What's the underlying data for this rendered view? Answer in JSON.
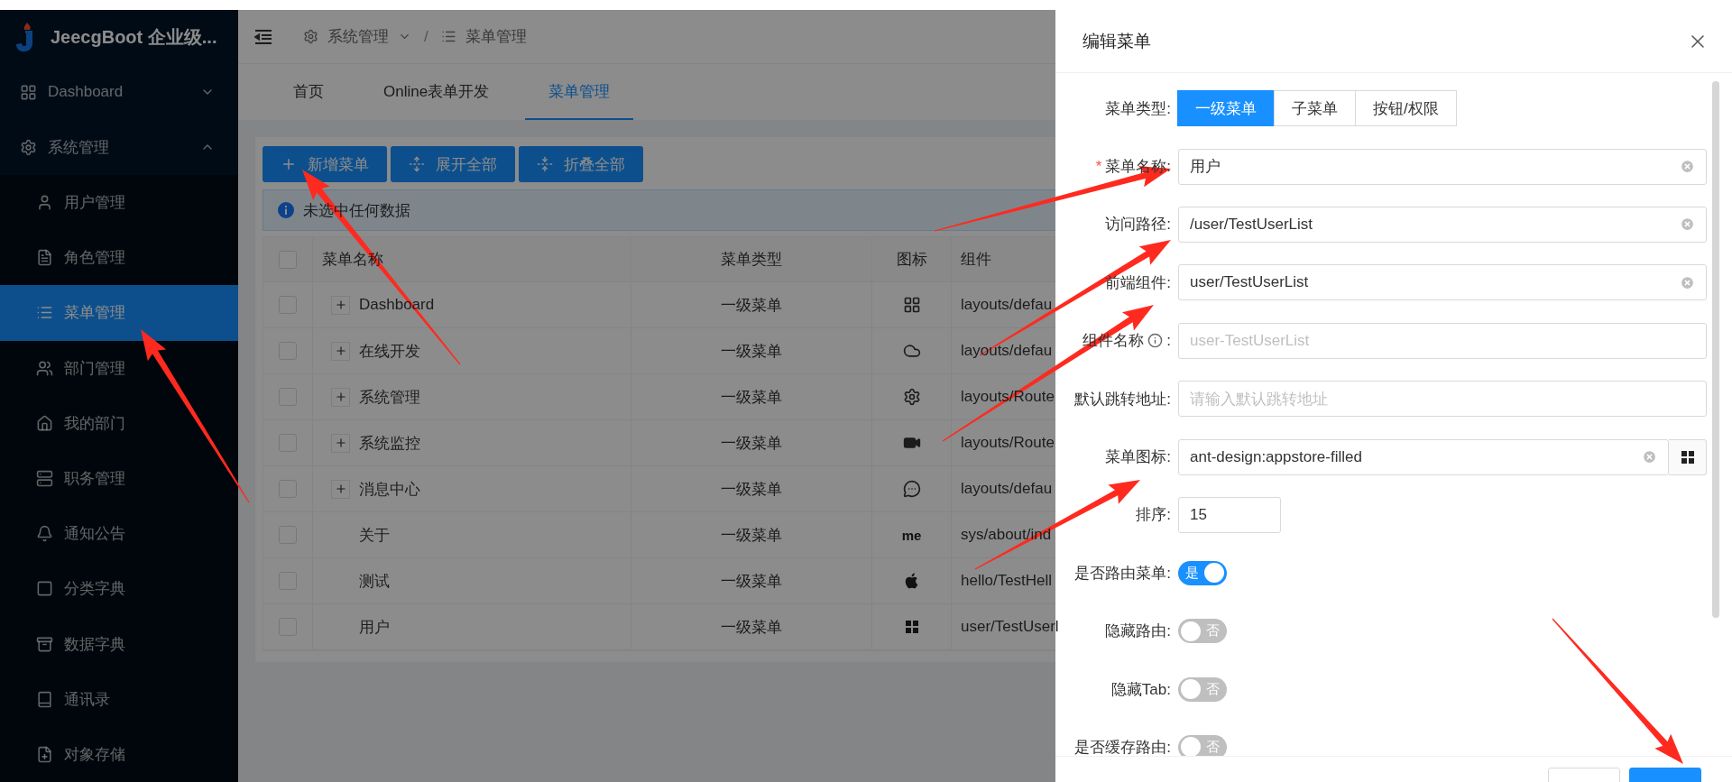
{
  "app": {
    "title": "JeecgBoot 企业级..."
  },
  "sidebar": {
    "items": [
      {
        "label": "Dashboard",
        "expanded": false
      },
      {
        "label": "系统管理",
        "expanded": true,
        "children": [
          {
            "label": "用户管理",
            "selected": false
          },
          {
            "label": "角色管理",
            "selected": false
          },
          {
            "label": "菜单管理",
            "selected": true
          },
          {
            "label": "部门管理",
            "selected": false
          },
          {
            "label": "我的部门",
            "selected": false
          },
          {
            "label": "职务管理",
            "selected": false
          },
          {
            "label": "通知公告",
            "selected": false
          },
          {
            "label": "分类字典",
            "selected": false
          },
          {
            "label": "数据字典",
            "selected": false
          },
          {
            "label": "通讯录",
            "selected": false
          },
          {
            "label": "对象存储",
            "selected": false
          }
        ]
      }
    ]
  },
  "breadcrumb": {
    "items": [
      "系统管理",
      "菜单管理"
    ],
    "separator": "/"
  },
  "tabs": [
    {
      "label": "首页",
      "selected": false
    },
    {
      "label": "Online表单开发",
      "selected": false
    },
    {
      "label": "菜单管理",
      "selected": true
    }
  ],
  "toolbar": {
    "buttons": [
      "新增菜单",
      "展开全部",
      "折叠全部"
    ]
  },
  "alert": {
    "text": "未选中任何数据"
  },
  "table": {
    "all_checked": false,
    "columns": [
      "菜单名称",
      "菜单类型",
      "图标",
      "组件"
    ],
    "rows": [
      {
        "checked": false,
        "name": "Dashboard",
        "expandable": true,
        "type": "一级菜单",
        "component": "layouts/defau"
      },
      {
        "checked": false,
        "name": "在线开发",
        "expandable": true,
        "type": "一级菜单",
        "component": "layouts/defau"
      },
      {
        "checked": false,
        "name": "系统管理",
        "expandable": true,
        "type": "一级菜单",
        "component": "layouts/Route"
      },
      {
        "checked": false,
        "name": "系统监控",
        "expandable": true,
        "type": "一级菜单",
        "component": "layouts/Route"
      },
      {
        "checked": false,
        "name": "消息中心",
        "expandable": true,
        "type": "一级菜单",
        "component": "layouts/defau"
      },
      {
        "checked": false,
        "name": "关于",
        "expandable": false,
        "type": "一级菜单",
        "icon_text": "me",
        "component": "sys/about/ind"
      },
      {
        "checked": false,
        "name": "测试",
        "expandable": false,
        "type": "一级菜单",
        "component": "hello/TestHell"
      },
      {
        "checked": false,
        "name": "用户",
        "expandable": false,
        "type": "一级菜单",
        "component": "user/TestUserl"
      }
    ]
  },
  "drawer": {
    "title": "编辑菜单",
    "fields": [
      {
        "kind": "segmented",
        "label": "菜单类型:",
        "options": [
          {
            "label": "一级菜单",
            "selected": true
          },
          {
            "label": "子菜单",
            "selected": false
          },
          {
            "label": "按钮/权限",
            "selected": false
          }
        ]
      },
      {
        "kind": "input",
        "label": "菜单名称:",
        "required_mark": "*",
        "value": "用户",
        "clearable": true
      },
      {
        "kind": "input",
        "label": "访问路径:",
        "value": "/user/TestUserList",
        "clearable": true
      },
      {
        "kind": "input",
        "label": "前端组件:",
        "value": "user/TestUserList",
        "clearable": true
      },
      {
        "kind": "input",
        "label": "组件名称",
        "info": true,
        "suffix": ":",
        "placeholder": "user-TestUserList",
        "clearable": false
      },
      {
        "kind": "input",
        "label": "默认跳转地址:",
        "placeholder": "请输入默认跳转地址",
        "clearable": false
      },
      {
        "kind": "icon_picker",
        "label": "菜单图标:",
        "value": "ant-design:appstore-filled",
        "clearable": true
      },
      {
        "kind": "number",
        "label": "排序:",
        "value": "15"
      },
      {
        "kind": "switch",
        "label": "是否路由菜单:",
        "on": true,
        "text": "是"
      },
      {
        "kind": "switch",
        "label": "隐藏路由:",
        "on": false,
        "text": "否"
      },
      {
        "kind": "switch",
        "label": "隐藏Tab:",
        "on": false,
        "text": "否"
      },
      {
        "kind": "switch",
        "label": "是否缓存路由:",
        "on": false,
        "text": "否"
      }
    ]
  },
  "annotations": [
    {
      "kind": "arrow"
    },
    {
      "kind": "arrow"
    },
    {
      "kind": "arrow"
    },
    {
      "kind": "arrow"
    },
    {
      "kind": "arrow"
    },
    {
      "kind": "arrow"
    },
    {
      "kind": "arrow"
    }
  ]
}
